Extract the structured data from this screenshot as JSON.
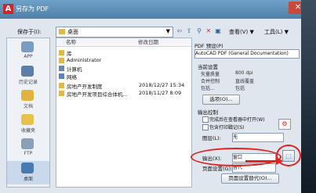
{
  "window": {
    "title": "另存为 PDF",
    "close_glyph": "✕"
  },
  "toolbar": {
    "save_in_label": "保存于(I):",
    "location": "桌面",
    "view_menu": "查看(V) ▼",
    "tools_menu": "工具(L) ▼"
  },
  "places": [
    {
      "label": "APP",
      "icon": "cloud-icon"
    },
    {
      "label": "历史记录",
      "icon": "history-icon"
    },
    {
      "label": "文档",
      "icon": "documents-icon"
    },
    {
      "label": "收藏夹",
      "icon": "favorites-icon"
    },
    {
      "label": "FTP",
      "icon": "ftp-icon"
    },
    {
      "label": "桌面",
      "icon": "desktop-icon"
    }
  ],
  "file_list": {
    "columns": {
      "name": "名称",
      "date": "修改日期"
    },
    "rows": [
      {
        "name": "库",
        "date": "",
        "icon_color": "#e4b93c"
      },
      {
        "name": "Administrator",
        "date": "",
        "icon_color": "#e4b93c"
      },
      {
        "name": "计算机",
        "date": "",
        "icon_color": "#6b88a8"
      },
      {
        "name": "网络",
        "date": "",
        "icon_color": "#5a83b8"
      },
      {
        "name": "房地产开发制度",
        "date": "2018/12/27 15:34",
        "icon_color": "#e4b93c"
      },
      {
        "name": "房地产开发项目综合体机...",
        "date": "2018/11/27 8:09",
        "icon_color": "#e4b93c"
      }
    ]
  },
  "settings": {
    "pdf_preset_label": "PDF 预设(P)",
    "pdf_preset_value": "AutoCAD PDF (General Documentation)",
    "current_settings_label": "当前设置",
    "rows": [
      {
        "key": "矢量质量",
        "val": "800 dpi"
      },
      {
        "key": "合并控制",
        "val": "直线覆盖"
      },
      {
        "key": "包括...",
        "val": "包括"
      }
    ],
    "options_button": "选项(O)...",
    "output_control_label": "输出控制",
    "open_viewer_label": "完成后在查看器中打开(W)",
    "include_plot_stamp_label": "包含打印戳记(S)",
    "layers_label": "图层(L):",
    "layers_value": "无",
    "export_label": "输出(X):",
    "export_value": "窗口",
    "page_setup_label": "页面设置(G):",
    "page_setup_value": "替代",
    "page_setup_override_button": "页面设置替代(O)..."
  },
  "colors": {
    "annotation": "#e32222",
    "titlebar": "#5b8bb5"
  }
}
